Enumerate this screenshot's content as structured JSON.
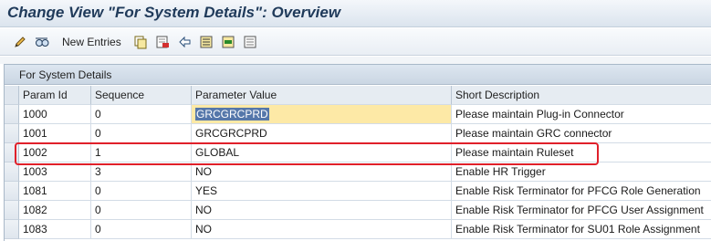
{
  "window": {
    "title": "Change View \"For System Details\": Overview"
  },
  "toolbar": {
    "new_entries_label": "New Entries"
  },
  "panel": {
    "title": "For System Details"
  },
  "table": {
    "headers": [
      "Param Id",
      "Sequence",
      "Parameter Value",
      "Short Description"
    ],
    "rows": [
      {
        "param_id": "1000",
        "sequence": "0",
        "value": "GRCGRCPRD",
        "desc": "Please maintain Plug-in Connector"
      },
      {
        "param_id": "1001",
        "sequence": "0",
        "value": "GRCGRCPRD",
        "desc": "Please maintain GRC connector"
      },
      {
        "param_id": "1002",
        "sequence": "1",
        "value": "GLOBAL",
        "desc": "Please maintain Ruleset"
      },
      {
        "param_id": "1003",
        "sequence": "3",
        "value": "NO",
        "desc": "Enable HR Trigger"
      },
      {
        "param_id": "1081",
        "sequence": "0",
        "value": "YES",
        "desc": "Enable Risk Terminator for PFCG Role Generation"
      },
      {
        "param_id": "1082",
        "sequence": "0",
        "value": "NO",
        "desc": "Enable Risk Terminator for PFCG User Assignment"
      },
      {
        "param_id": "1083",
        "sequence": "0",
        "value": "NO",
        "desc": "Enable Risk Terminator for SU01 Role Assignment"
      }
    ]
  },
  "colors": {
    "highlight": "#e0202a",
    "input_active": "#fde9a6",
    "selection": "#5577aa"
  },
  "icons": [
    "edit-pencil-icon",
    "display-glasses-icon",
    "copy-icon",
    "delete-icon",
    "undo-icon",
    "select-all-icon",
    "select-block-icon",
    "deselect-all-icon"
  ]
}
